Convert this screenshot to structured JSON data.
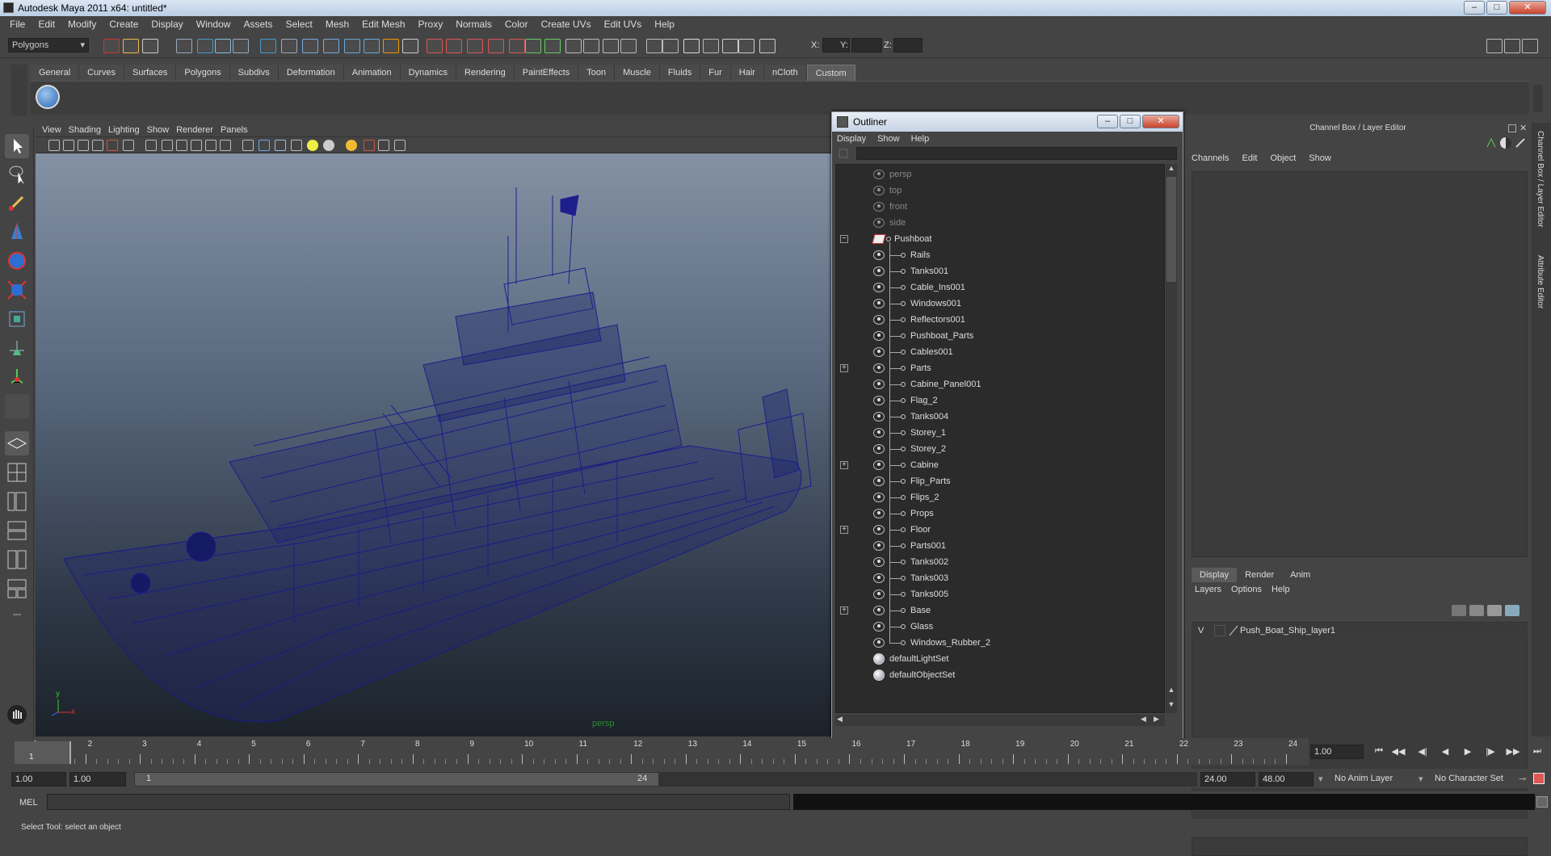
{
  "window": {
    "title": "Autodesk Maya 2011 x64: untitled*"
  },
  "menubar": [
    "File",
    "Edit",
    "Modify",
    "Create",
    "Display",
    "Window",
    "Assets",
    "Select",
    "Mesh",
    "Edit Mesh",
    "Proxy",
    "Normals",
    "Color",
    "Create UVs",
    "Edit UVs",
    "Help"
  ],
  "status_line": {
    "mode": "Polygons",
    "x_label": "X:",
    "y_label": "Y:",
    "z_label": "Z:"
  },
  "shelf": {
    "tabs": [
      "General",
      "Curves",
      "Surfaces",
      "Polygons",
      "Subdivs",
      "Deformation",
      "Animation",
      "Dynamics",
      "Rendering",
      "PaintEffects",
      "Toon",
      "Muscle",
      "Fluids",
      "Fur",
      "Hair",
      "nCloth",
      "Custom"
    ],
    "active": "Custom"
  },
  "viewport": {
    "menu": [
      "View",
      "Shading",
      "Lighting",
      "Show",
      "Renderer",
      "Panels"
    ],
    "camera_label": "persp",
    "axis_y": "y",
    "axis_z": "z",
    "axis_x": "x"
  },
  "outliner": {
    "title": "Outliner",
    "menu": [
      "Display",
      "Show",
      "Help"
    ],
    "items": [
      {
        "label": "persp",
        "level": 0,
        "type": "camera",
        "dim": true
      },
      {
        "label": "top",
        "level": 0,
        "type": "camera",
        "dim": true
      },
      {
        "label": "front",
        "level": 0,
        "type": "camera",
        "dim": true
      },
      {
        "label": "side",
        "level": 0,
        "type": "camera",
        "dim": true
      },
      {
        "label": "Pushboat",
        "level": 0,
        "type": "group",
        "expand": "minus"
      },
      {
        "label": "Rails",
        "level": 1,
        "type": "mesh"
      },
      {
        "label": "Tanks001",
        "level": 1,
        "type": "mesh"
      },
      {
        "label": "Cable_Ins001",
        "level": 1,
        "type": "mesh"
      },
      {
        "label": "Windows001",
        "level": 1,
        "type": "mesh"
      },
      {
        "label": "Reflectors001",
        "level": 1,
        "type": "mesh"
      },
      {
        "label": "Pushboat_Parts",
        "level": 1,
        "type": "mesh"
      },
      {
        "label": "Cables001",
        "level": 1,
        "type": "mesh"
      },
      {
        "label": "Parts",
        "level": 1,
        "type": "mesh",
        "expand": "plus"
      },
      {
        "label": "Cabine_Panel001",
        "level": 1,
        "type": "mesh"
      },
      {
        "label": "Flag_2",
        "level": 1,
        "type": "mesh"
      },
      {
        "label": "Tanks004",
        "level": 1,
        "type": "mesh"
      },
      {
        "label": "Storey_1",
        "level": 1,
        "type": "mesh"
      },
      {
        "label": "Storey_2",
        "level": 1,
        "type": "mesh"
      },
      {
        "label": "Cabine",
        "level": 1,
        "type": "mesh",
        "expand": "plus"
      },
      {
        "label": "Flip_Parts",
        "level": 1,
        "type": "mesh"
      },
      {
        "label": "Flips_2",
        "level": 1,
        "type": "mesh"
      },
      {
        "label": "Props",
        "level": 1,
        "type": "mesh"
      },
      {
        "label": "Floor",
        "level": 1,
        "type": "mesh",
        "expand": "plus"
      },
      {
        "label": "Parts001",
        "level": 1,
        "type": "mesh"
      },
      {
        "label": "Tanks002",
        "level": 1,
        "type": "mesh"
      },
      {
        "label": "Tanks003",
        "level": 1,
        "type": "mesh"
      },
      {
        "label": "Tanks005",
        "level": 1,
        "type": "mesh"
      },
      {
        "label": "Base",
        "level": 1,
        "type": "mesh",
        "expand": "plus"
      },
      {
        "label": "Glass",
        "level": 1,
        "type": "mesh"
      },
      {
        "label": "Windows_Rubber_2",
        "level": 1,
        "type": "mesh"
      },
      {
        "label": "defaultLightSet",
        "level": 0,
        "type": "set"
      },
      {
        "label": "defaultObjectSet",
        "level": 0,
        "type": "set"
      }
    ]
  },
  "channel_box": {
    "title": "Channel Box / Layer Editor",
    "menu": [
      "Channels",
      "Edit",
      "Object",
      "Show"
    ],
    "layer_tabs": [
      "Display",
      "Render",
      "Anim"
    ],
    "active_layer_tab": "Display",
    "layer_menu": [
      "Layers",
      "Options",
      "Help"
    ],
    "layers": [
      {
        "visible": "V",
        "name": "Push_Boat_Ship_layer1"
      }
    ],
    "side_tabs": [
      "Channel Box / Layer Editor",
      "Attribute Editor"
    ]
  },
  "timeslider": {
    "ticks": [
      "1",
      "2",
      "3",
      "4",
      "5",
      "6",
      "7",
      "8",
      "9",
      "10",
      "11",
      "12",
      "13",
      "14",
      "15",
      "16",
      "17",
      "18",
      "19",
      "20",
      "21",
      "22",
      "23",
      "24"
    ],
    "current_frame": "1.00",
    "playhead": "1"
  },
  "range": {
    "start": "1.00",
    "anim_start": "1.00",
    "slider_start": "1",
    "slider_end": "24",
    "end": "24.00",
    "anim_end": "48.00",
    "anim_layer": "No Anim Layer",
    "character_set": "No Character Set"
  },
  "command_line": {
    "label": "MEL"
  },
  "help_line": {
    "text": "Select Tool: select an object"
  }
}
